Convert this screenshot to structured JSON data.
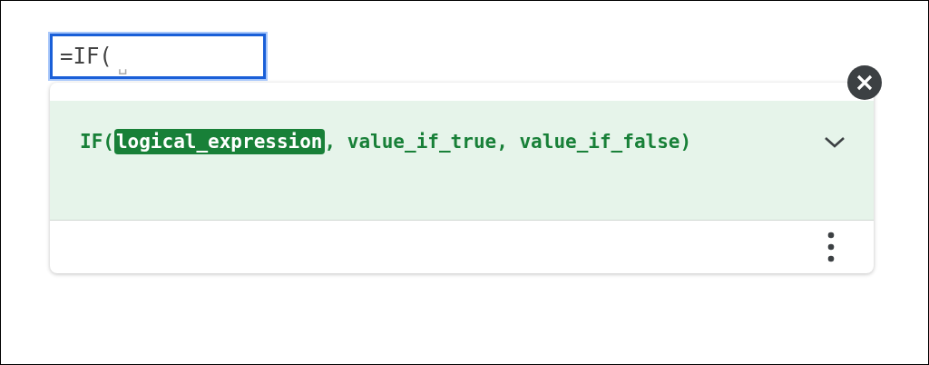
{
  "cell_input": {
    "value": "=IF(",
    "space_marker": "␣"
  },
  "formula_help": {
    "signature": "IF(**logical_expression**, value_if_true, value_if_false)",
    "expanded": false
  }
}
